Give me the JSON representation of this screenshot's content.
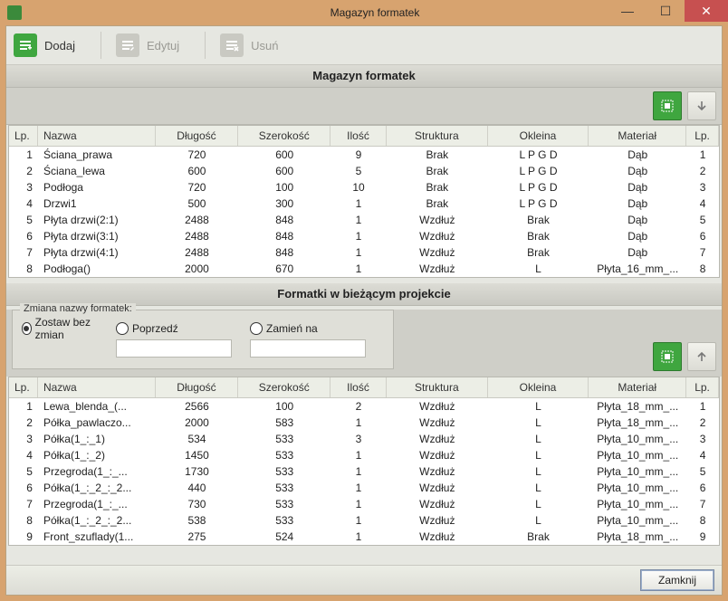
{
  "window": {
    "title": "Magazyn formatek"
  },
  "toolbar": {
    "add": "Dodaj",
    "edit": "Edytuj",
    "del": "Usuń"
  },
  "section1": {
    "title": "Magazyn formatek",
    "columns": {
      "lp": "Lp.",
      "name": "Nazwa",
      "len": "Długość",
      "wid": "Szerokość",
      "qty": "Ilość",
      "str": "Struktura",
      "okl": "Okleina",
      "mat": "Materiał",
      "lp2": "Lp."
    },
    "rows": [
      {
        "lp": "1",
        "name": "Ściana_prawa",
        "len": "720",
        "wid": "600",
        "qty": "9",
        "str": "Brak",
        "okl": "L P G D",
        "mat": "Dąb",
        "lp2": "1"
      },
      {
        "lp": "2",
        "name": "Ściana_lewa",
        "len": "600",
        "wid": "600",
        "qty": "5",
        "str": "Brak",
        "okl": "L P G D",
        "mat": "Dąb",
        "lp2": "2"
      },
      {
        "lp": "3",
        "name": "Podłoga",
        "len": "720",
        "wid": "100",
        "qty": "10",
        "str": "Brak",
        "okl": "L P G D",
        "mat": "Dąb",
        "lp2": "3"
      },
      {
        "lp": "4",
        "name": "Drzwi1",
        "len": "500",
        "wid": "300",
        "qty": "1",
        "str": "Brak",
        "okl": "L P G D",
        "mat": "Dąb",
        "lp2": "4"
      },
      {
        "lp": "5",
        "name": "Płyta drzwi(2:1)",
        "len": "2488",
        "wid": "848",
        "qty": "1",
        "str": "Wzdłuż",
        "okl": "Brak",
        "mat": "Dąb",
        "lp2": "5"
      },
      {
        "lp": "6",
        "name": "Płyta drzwi(3:1)",
        "len": "2488",
        "wid": "848",
        "qty": "1",
        "str": "Wzdłuż",
        "okl": "Brak",
        "mat": "Dąb",
        "lp2": "6"
      },
      {
        "lp": "7",
        "name": "Płyta drzwi(4:1)",
        "len": "2488",
        "wid": "848",
        "qty": "1",
        "str": "Wzdłuż",
        "okl": "Brak",
        "mat": "Dąb",
        "lp2": "7"
      },
      {
        "lp": "8",
        "name": "Podłoga()",
        "len": "2000",
        "wid": "670",
        "qty": "1",
        "str": "Wzdłuż",
        "okl": "L",
        "mat": "Płyta_16_mm_...",
        "lp2": "8"
      }
    ]
  },
  "section2": {
    "title": "Formatki w bieżącym projekcie",
    "rename": {
      "legend": "Zmiana nazwy formatek:",
      "keep": "Zostaw bez zmian",
      "prepend": "Poprzedź",
      "replace": "Zamień na"
    },
    "columns": {
      "lp": "Lp.",
      "name": "Nazwa",
      "len": "Długość",
      "wid": "Szerokość",
      "qty": "Ilość",
      "str": "Struktura",
      "okl": "Okleina",
      "mat": "Materiał",
      "lp2": "Lp."
    },
    "rows": [
      {
        "lp": "1",
        "name": "Lewa_blenda_(...",
        "len": "2566",
        "wid": "100",
        "qty": "2",
        "str": "Wzdłuż",
        "okl": "L",
        "mat": "Płyta_18_mm_...",
        "lp2": "1"
      },
      {
        "lp": "2",
        "name": "Półka_pawlaczo...",
        "len": "2000",
        "wid": "583",
        "qty": "1",
        "str": "Wzdłuż",
        "okl": "L",
        "mat": "Płyta_18_mm_...",
        "lp2": "2"
      },
      {
        "lp": "3",
        "name": "Półka(1_:_1)",
        "len": "534",
        "wid": "533",
        "qty": "3",
        "str": "Wzdłuż",
        "okl": "L",
        "mat": "Płyta_10_mm_...",
        "lp2": "3"
      },
      {
        "lp": "4",
        "name": "Półka(1_:_2)",
        "len": "1450",
        "wid": "533",
        "qty": "1",
        "str": "Wzdłuż",
        "okl": "L",
        "mat": "Płyta_10_mm_...",
        "lp2": "4"
      },
      {
        "lp": "5",
        "name": "Przegroda(1_:_...",
        "len": "1730",
        "wid": "533",
        "qty": "1",
        "str": "Wzdłuż",
        "okl": "L",
        "mat": "Płyta_10_mm_...",
        "lp2": "5"
      },
      {
        "lp": "6",
        "name": "Półka(1_:_2_:_2...",
        "len": "440",
        "wid": "533",
        "qty": "1",
        "str": "Wzdłuż",
        "okl": "L",
        "mat": "Płyta_10_mm_...",
        "lp2": "6"
      },
      {
        "lp": "7",
        "name": "Przegroda(1_:_...",
        "len": "730",
        "wid": "533",
        "qty": "1",
        "str": "Wzdłuż",
        "okl": "L",
        "mat": "Płyta_10_mm_...",
        "lp2": "7"
      },
      {
        "lp": "8",
        "name": "Półka(1_:_2_:_2...",
        "len": "538",
        "wid": "533",
        "qty": "1",
        "str": "Wzdłuż",
        "okl": "L",
        "mat": "Płyta_10_mm_...",
        "lp2": "8"
      },
      {
        "lp": "9",
        "name": "Front_szuflady(1...",
        "len": "275",
        "wid": "524",
        "qty": "1",
        "str": "Wzdłuż",
        "okl": "Brak",
        "mat": "Płyta_18_mm_...",
        "lp2": "9"
      }
    ]
  },
  "footer": {
    "close": "Zamknij"
  }
}
